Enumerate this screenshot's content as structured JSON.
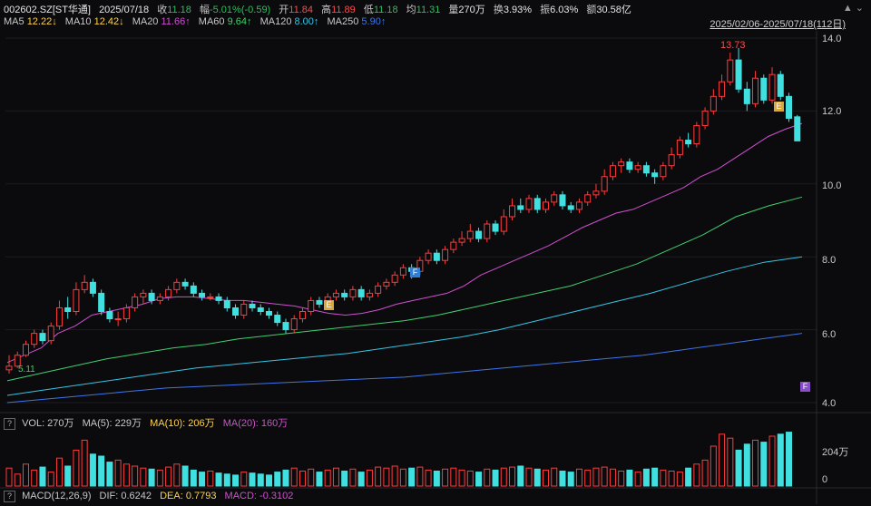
{
  "header": {
    "symbol": "002602.SZ[ST华通]",
    "date": "2025/07/18",
    "close_label": "收",
    "close_value": "11.18",
    "change_label": "幅",
    "change_value": "-5.01%(-0.59)",
    "open_label": "开",
    "open_value": "11.84",
    "high_label": "高",
    "high_value": "11.89",
    "low_label": "低",
    "low_value": "11.18",
    "avg_label": "均",
    "avg_value": "11.31",
    "vol_label": "量",
    "vol_value": "270万",
    "turnover_label": "换",
    "turnover_value": "3.93%",
    "amp_label": "振",
    "amp_value": "6.03%",
    "amount_label": "额",
    "amount_value": "30.58亿",
    "range": "2025/02/06-2025/07/18(112日)",
    "icons": "▲ ⌄"
  },
  "ma_legend": [
    {
      "name": "MA5",
      "value": "12.22↓",
      "color": "#ffd24a"
    },
    {
      "name": "MA10",
      "value": "12.42↓",
      "color": "#ffd24a"
    },
    {
      "name": "MA20",
      "value": "11.66↑",
      "color": "#d14fd1"
    },
    {
      "name": "MA60",
      "value": "9.64↑",
      "color": "#3fd070"
    },
    {
      "name": "MA120",
      "value": "8.00↑",
      "color": "#35c5e5"
    },
    {
      "name": "MA250",
      "value": "5.90↑",
      "color": "#3f74e8"
    }
  ],
  "price_axis": [
    "14.0",
    "12.0",
    "10.0",
    "8.0",
    "6.0",
    "4.0"
  ],
  "annotations": {
    "high": "13.73",
    "low_marker": "5.11"
  },
  "volume": {
    "label": "VOL: 270万",
    "ma5": "MA(5): 229万",
    "ma10": "MA(10): 206万",
    "ma20": "MA(20): 160万",
    "axis_top": "204万",
    "axis_bottom": "0"
  },
  "macd": {
    "label": "MACD(12,26,9)",
    "dif": "DIF: 0.6242",
    "dea": "DEA: 0.7793",
    "macd": "MACD: -0.3102"
  },
  "badges": {
    "f1": "F",
    "e1": "E",
    "e2": "E",
    "f2": "F"
  },
  "chart_data": {
    "type": "candlestick",
    "ylim": [
      4.0,
      14.0
    ],
    "colors": {
      "up": "#ff3b3b",
      "down": "#41e0e0"
    },
    "candles": [
      [
        4.9,
        5.0,
        5.3,
        4.8
      ],
      [
        5.0,
        5.3,
        5.4,
        4.95
      ],
      [
        5.3,
        5.6,
        5.7,
        5.25
      ],
      [
        5.6,
        5.9,
        6.0,
        5.5
      ],
      [
        5.9,
        5.7,
        6.0,
        5.6
      ],
      [
        5.7,
        6.1,
        6.2,
        5.6
      ],
      [
        6.1,
        6.6,
        6.8,
        6.0
      ],
      [
        6.6,
        6.5,
        6.9,
        6.3
      ],
      [
        6.5,
        7.1,
        7.3,
        6.4
      ],
      [
        7.1,
        7.3,
        7.5,
        7.0
      ],
      [
        7.3,
        7.0,
        7.4,
        6.9
      ],
      [
        7.0,
        6.5,
        7.1,
        6.4
      ],
      [
        6.5,
        6.3,
        6.6,
        6.2
      ],
      [
        6.3,
        6.3,
        6.5,
        6.1
      ],
      [
        6.3,
        6.6,
        6.7,
        6.2
      ],
      [
        6.6,
        6.9,
        7.0,
        6.5
      ],
      [
        6.9,
        7.0,
        7.1,
        6.7
      ],
      [
        7.0,
        6.8,
        7.1,
        6.7
      ],
      [
        6.8,
        6.9,
        7.0,
        6.7
      ],
      [
        6.9,
        7.1,
        7.2,
        6.8
      ],
      [
        7.1,
        7.3,
        7.4,
        7.0
      ],
      [
        7.3,
        7.2,
        7.4,
        7.1
      ],
      [
        7.2,
        7.0,
        7.3,
        6.9
      ],
      [
        7.0,
        6.9,
        7.1,
        6.8
      ],
      [
        6.9,
        6.9,
        7.0,
        6.8
      ],
      [
        6.9,
        6.8,
        7.0,
        6.7
      ],
      [
        6.8,
        6.6,
        6.9,
        6.5
      ],
      [
        6.6,
        6.4,
        6.7,
        6.3
      ],
      [
        6.4,
        6.7,
        6.8,
        6.3
      ],
      [
        6.7,
        6.6,
        6.8,
        6.5
      ],
      [
        6.6,
        6.5,
        6.7,
        6.4
      ],
      [
        6.5,
        6.4,
        6.6,
        6.3
      ],
      [
        6.4,
        6.2,
        6.5,
        6.1
      ],
      [
        6.2,
        6.0,
        6.3,
        5.9
      ],
      [
        6.0,
        6.3,
        6.4,
        5.9
      ],
      [
        6.3,
        6.5,
        6.6,
        6.2
      ],
      [
        6.5,
        6.8,
        6.9,
        6.4
      ],
      [
        6.8,
        6.7,
        6.9,
        6.6
      ],
      [
        6.7,
        6.9,
        7.0,
        6.6
      ],
      [
        6.9,
        7.0,
        7.1,
        6.8
      ],
      [
        7.0,
        6.9,
        7.1,
        6.8
      ],
      [
        6.9,
        7.1,
        7.2,
        6.8
      ],
      [
        7.1,
        6.9,
        7.2,
        6.8
      ],
      [
        6.9,
        7.0,
        7.1,
        6.8
      ],
      [
        7.0,
        7.2,
        7.3,
        6.9
      ],
      [
        7.2,
        7.3,
        7.4,
        7.1
      ],
      [
        7.3,
        7.5,
        7.6,
        7.2
      ],
      [
        7.5,
        7.7,
        7.8,
        7.4
      ],
      [
        7.7,
        7.6,
        7.8,
        7.4
      ],
      [
        7.6,
        7.9,
        8.0,
        7.5
      ],
      [
        7.9,
        8.1,
        8.2,
        7.8
      ],
      [
        8.1,
        7.9,
        8.2,
        7.8
      ],
      [
        7.9,
        8.2,
        8.3,
        7.8
      ],
      [
        8.2,
        8.4,
        8.5,
        8.1
      ],
      [
        8.4,
        8.5,
        8.7,
        8.3
      ],
      [
        8.5,
        8.7,
        8.9,
        8.4
      ],
      [
        8.7,
        8.5,
        8.8,
        8.4
      ],
      [
        8.5,
        8.9,
        9.0,
        8.4
      ],
      [
        8.9,
        8.7,
        9.0,
        8.6
      ],
      [
        8.7,
        9.1,
        9.3,
        8.6
      ],
      [
        9.1,
        9.4,
        9.6,
        9.0
      ],
      [
        9.4,
        9.3,
        9.6,
        9.2
      ],
      [
        9.3,
        9.6,
        9.7,
        9.2
      ],
      [
        9.6,
        9.3,
        9.7,
        9.2
      ],
      [
        9.3,
        9.5,
        9.6,
        9.2
      ],
      [
        9.5,
        9.7,
        9.8,
        9.4
      ],
      [
        9.7,
        9.4,
        9.8,
        9.3
      ],
      [
        9.4,
        9.3,
        9.5,
        9.2
      ],
      [
        9.3,
        9.5,
        9.6,
        9.2
      ],
      [
        9.5,
        9.7,
        9.8,
        9.4
      ],
      [
        9.7,
        9.8,
        10.0,
        9.6
      ],
      [
        9.8,
        10.2,
        10.4,
        9.7
      ],
      [
        10.2,
        10.5,
        10.6,
        10.1
      ],
      [
        10.5,
        10.6,
        10.7,
        10.3
      ],
      [
        10.6,
        10.4,
        10.7,
        10.3
      ],
      [
        10.4,
        10.5,
        10.6,
        10.3
      ],
      [
        10.5,
        10.3,
        10.6,
        10.2
      ],
      [
        10.3,
        10.2,
        10.4,
        10.0
      ],
      [
        10.2,
        10.5,
        10.6,
        10.1
      ],
      [
        10.5,
        10.8,
        11.0,
        10.4
      ],
      [
        10.8,
        11.2,
        11.3,
        10.7
      ],
      [
        11.2,
        11.1,
        11.4,
        11.0
      ],
      [
        11.1,
        11.6,
        11.7,
        11.0
      ],
      [
        11.6,
        12.0,
        12.1,
        11.5
      ],
      [
        12.0,
        12.4,
        12.6,
        11.9
      ],
      [
        12.4,
        12.8,
        13.0,
        12.3
      ],
      [
        12.8,
        13.4,
        13.6,
        12.7
      ],
      [
        13.4,
        12.6,
        13.73,
        12.5
      ],
      [
        12.6,
        12.2,
        12.8,
        12.0
      ],
      [
        12.2,
        12.9,
        13.1,
        12.1
      ],
      [
        12.9,
        12.3,
        13.0,
        12.2
      ],
      [
        12.3,
        13.0,
        13.2,
        12.2
      ],
      [
        13.0,
        12.4,
        13.1,
        12.3
      ],
      [
        12.4,
        11.8,
        12.5,
        11.7
      ],
      [
        11.84,
        11.18,
        11.89,
        11.18
      ]
    ],
    "ma20_points": [
      5.1,
      5.3,
      5.5,
      5.9,
      6.1,
      6.4,
      6.5,
      6.6,
      6.7,
      6.85,
      6.9,
      6.9,
      6.85,
      6.8,
      6.8,
      6.75,
      6.7,
      6.65,
      6.55,
      6.45,
      6.4,
      6.45,
      6.55,
      6.7,
      6.8,
      6.9,
      7.0,
      7.2,
      7.5,
      7.7,
      7.9,
      8.1,
      8.3,
      8.55,
      8.8,
      9.0,
      9.2,
      9.3,
      9.5,
      9.7,
      9.9,
      10.2,
      10.4,
      10.7,
      11.0,
      11.3,
      11.5,
      11.66
    ],
    "ma60_points": [
      4.6,
      4.8,
      5.0,
      5.2,
      5.35,
      5.5,
      5.6,
      5.75,
      5.85,
      5.95,
      6.05,
      6.15,
      6.25,
      6.4,
      6.6,
      6.8,
      7.0,
      7.2,
      7.5,
      7.8,
      8.2,
      8.6,
      9.1,
      9.4,
      9.64
    ],
    "ma120_points": [
      4.2,
      4.35,
      4.5,
      4.65,
      4.8,
      4.95,
      5.05,
      5.15,
      5.25,
      5.35,
      5.5,
      5.65,
      5.8,
      6.0,
      6.25,
      6.5,
      6.75,
      7.0,
      7.3,
      7.6,
      7.85,
      8.0
    ],
    "ma250_points": [
      4.0,
      4.1,
      4.2,
      4.3,
      4.4,
      4.45,
      4.5,
      4.55,
      4.6,
      4.65,
      4.7,
      4.8,
      4.9,
      5.0,
      5.1,
      5.2,
      5.3,
      5.45,
      5.6,
      5.75,
      5.9
    ],
    "volume_values": [
      90,
      60,
      110,
      80,
      95,
      70,
      140,
      100,
      180,
      230,
      160,
      150,
      120,
      130,
      110,
      100,
      90,
      85,
      80,
      95,
      110,
      100,
      80,
      70,
      75,
      65,
      60,
      55,
      70,
      65,
      60,
      55,
      70,
      80,
      90,
      75,
      85,
      70,
      80,
      90,
      75,
      85,
      70,
      80,
      95,
      90,
      100,
      85,
      90,
      95,
      80,
      75,
      85,
      90,
      80,
      75,
      70,
      85,
      80,
      90,
      95,
      100,
      90,
      85,
      80,
      90,
      75,
      70,
      85,
      80,
      90,
      95,
      85,
      75,
      80,
      70,
      85,
      90,
      80,
      75,
      70,
      90,
      110,
      130,
      200,
      260,
      240,
      180,
      210,
      230,
      220,
      250,
      260,
      270
    ],
    "volume_ylim": [
      0,
      300
    ]
  }
}
